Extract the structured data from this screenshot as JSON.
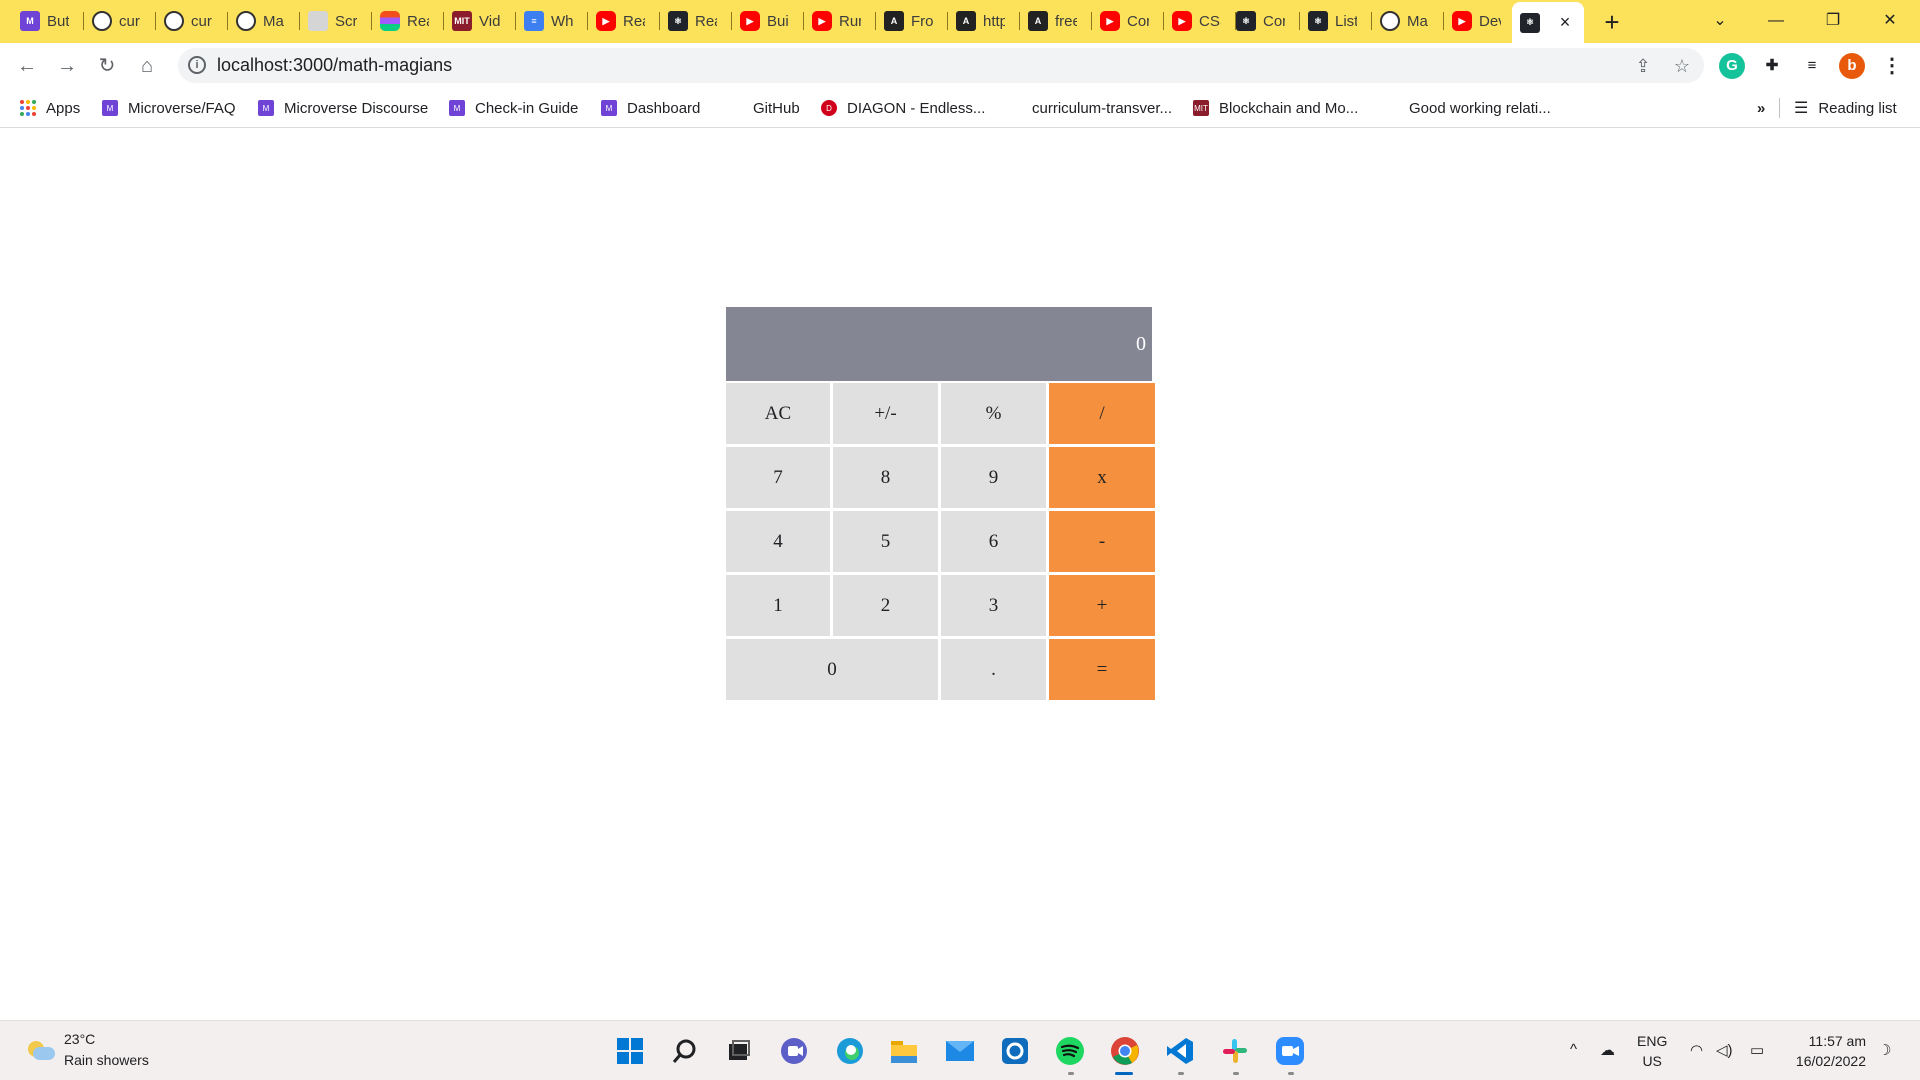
{
  "browser": {
    "tabs": [
      {
        "label": "But",
        "favicon": "microverse-icon"
      },
      {
        "label": "cur",
        "favicon": "github-icon"
      },
      {
        "label": "cur",
        "favicon": "github-icon"
      },
      {
        "label": "Ma",
        "favicon": "github-icon"
      },
      {
        "label": "Scr",
        "favicon": "scribe-icon"
      },
      {
        "label": "Rea",
        "favicon": "figma-icon"
      },
      {
        "label": "Vid",
        "favicon": "mit-icon"
      },
      {
        "label": "Wh",
        "favicon": "docs-icon"
      },
      {
        "label": "Rea",
        "favicon": "youtube-icon"
      },
      {
        "label": "Rea",
        "favicon": "react-icon"
      },
      {
        "label": "Bui",
        "favicon": "youtube-icon"
      },
      {
        "label": "Rur",
        "favicon": "youtube-icon"
      },
      {
        "label": "Fro",
        "favicon": "aws-icon"
      },
      {
        "label": "http",
        "favicon": "aws-icon"
      },
      {
        "label": "free",
        "favicon": "aws-icon"
      },
      {
        "label": "Cor",
        "favicon": "youtube-icon"
      },
      {
        "label": "CSS",
        "favicon": "youtube-icon"
      },
      {
        "label": "Cor",
        "favicon": "react-icon"
      },
      {
        "label": "List",
        "favicon": "react-icon"
      },
      {
        "label": "Ma",
        "favicon": "github-icon"
      },
      {
        "label": "Dev",
        "favicon": "youtube-icon"
      }
    ],
    "active_tab_favicon": "react-icon",
    "close_tab_icon": "×",
    "new_tab_icon": "+",
    "tab_search_icon": "⌄",
    "minimize_icon": "—",
    "restore_icon": "❐",
    "close_window_icon": "✕",
    "tabstrip_color": "#fbe25a"
  },
  "toolbar": {
    "back_icon": "←",
    "forward_icon": "→",
    "reload_icon": "↻",
    "home_icon": "⌂",
    "address": "localhost:3000/math-magians",
    "info_icon": "i",
    "share_icon": "⇪",
    "bookmark_star_icon": "☆",
    "extension_grammarly": "G",
    "extensions_icon": "✚",
    "media_icon": "≡",
    "profile_initial": "b",
    "menu_icon": "⋮"
  },
  "bookmarks": {
    "apps_label": "Apps",
    "items": [
      {
        "label": "Microverse/FAQ"
      },
      {
        "label": "Microverse Discourse"
      },
      {
        "label": "Check-in Guide"
      },
      {
        "label": "Dashboard"
      },
      {
        "label": "GitHub"
      },
      {
        "label": "DIAGON - Endless..."
      },
      {
        "label": "curriculum-transver..."
      },
      {
        "label": "Blockchain and Mo..."
      },
      {
        "label": "Good working relati..."
      }
    ],
    "overflow_icon": "»",
    "reading_list_label": "Reading list",
    "reading_list_icon": "☰"
  },
  "calculator": {
    "display": "0",
    "display_color": "#858694",
    "operator_color": "#f5913e",
    "key_color": "#e0e0e0",
    "keys": {
      "ac": "AC",
      "sign": "+/-",
      "percent": "%",
      "divide": "/",
      "seven": "7",
      "eight": "8",
      "nine": "9",
      "multiply": "x",
      "four": "4",
      "five": "5",
      "six": "6",
      "subtract": "-",
      "one": "1",
      "two": "2",
      "three": "3",
      "add": "+",
      "zero": "0",
      "decimal": ".",
      "equals": "="
    }
  },
  "taskbar": {
    "weather_temp": "23°C",
    "weather_desc": "Rain showers",
    "lang_line1": "ENG",
    "lang_line2": "US",
    "time": "11:57 am",
    "date": "16/02/2022",
    "tray_chevron_icon": "^",
    "onedrive_icon": "☁",
    "wifi_icon": "◠",
    "volume_icon": "◁)",
    "battery_icon": "▭",
    "notification_icon": "☽"
  }
}
